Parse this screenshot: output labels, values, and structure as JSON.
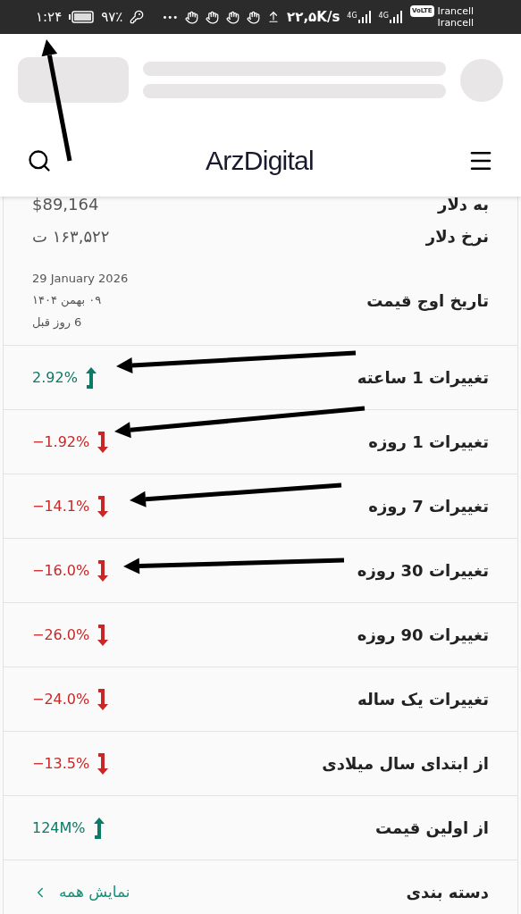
{
  "status_bar": {
    "time": "۱:۲۴",
    "battery": "۹۷٪",
    "more": "•••",
    "speed": "۲۲,۵K/s",
    "network_labels": [
      "4G",
      "4G"
    ],
    "volte": "VoLTE",
    "carriers": [
      "Irancell",
      "Irancell"
    ]
  },
  "header": {
    "logo": "ArzDigital"
  },
  "top_rows": [
    {
      "label": "به دلار",
      "value": "$89,164"
    },
    {
      "label": "نرخ دلار",
      "value": "۱۶۳,۵۲۲ ت"
    }
  ],
  "peak": {
    "label": "تاریخ اوج قیمت",
    "lines": [
      "29 January 2026",
      "۰۹ بهمن ۱۴۰۴",
      "6 روز قبل"
    ]
  },
  "rows": [
    {
      "kind": "change",
      "label": "تغییرات 1 ساعته",
      "value": "2.92%",
      "rising": true
    },
    {
      "kind": "change",
      "label": "تغییرات 1 روزه",
      "value": "−1.92%",
      "rising": false
    },
    {
      "kind": "change",
      "label": "تغییرات 7 روزه",
      "value": "−14.1%",
      "rising": false
    },
    {
      "kind": "change",
      "label": "تغییرات 30 روزه",
      "value": "−16.0%",
      "rising": false
    },
    {
      "kind": "change",
      "label": "تغییرات 90 روزه",
      "value": "−26.0%",
      "rising": false
    },
    {
      "kind": "change",
      "label": "تغییرات یک ساله",
      "value": "−24.0%",
      "rising": false
    },
    {
      "kind": "change",
      "label": "از ابتدای سال میلادی",
      "value": "−13.5%",
      "rising": false
    },
    {
      "kind": "change",
      "label": "از اولین قیمت",
      "value": "124M%",
      "rising": true
    },
    {
      "kind": "link",
      "label": "دسته بندی",
      "value": "نمایش همه"
    }
  ]
}
